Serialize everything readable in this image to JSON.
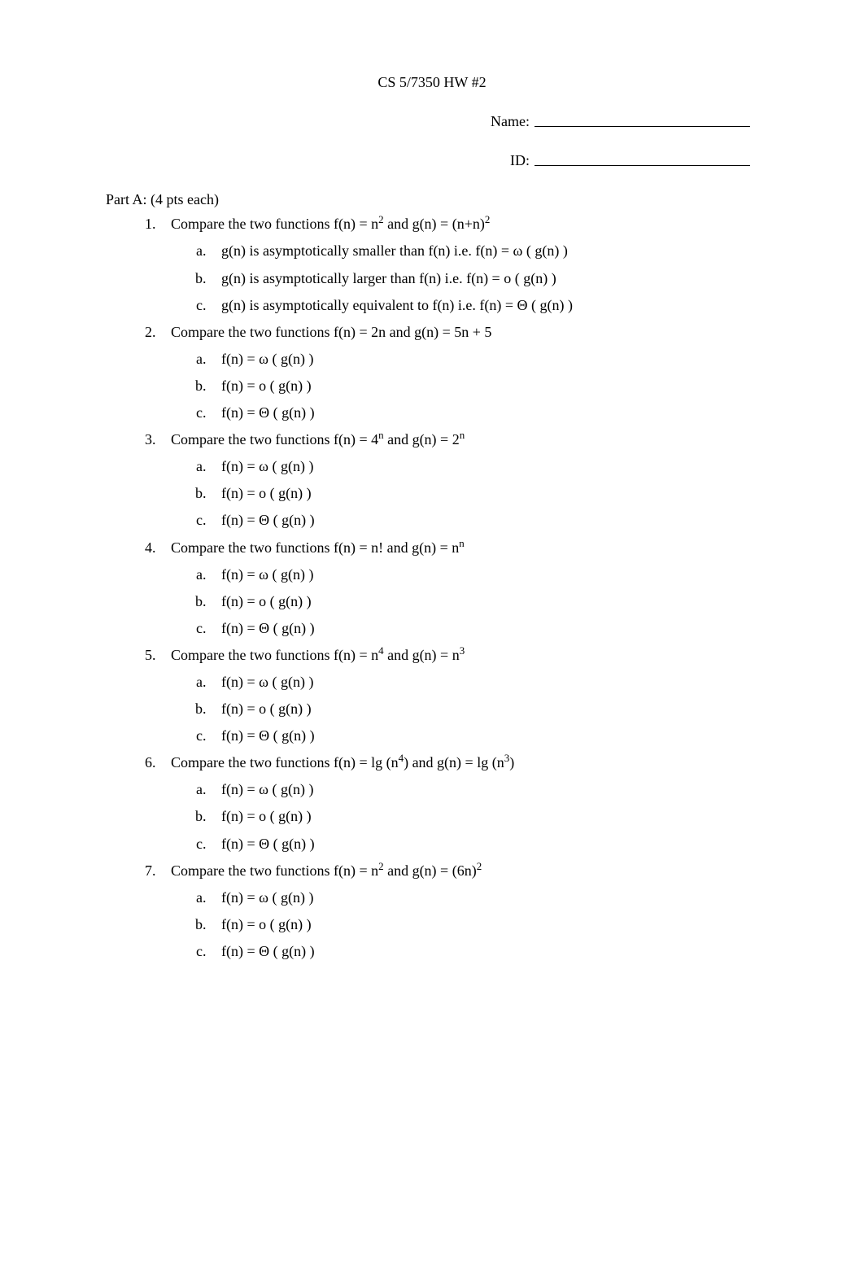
{
  "header": {
    "title": "CS 5/7350 HW #2",
    "name_label": "Name:",
    "name_value": "",
    "id_label": "ID:",
    "id_value": ""
  },
  "part_a": {
    "heading": "Part A: (4 pts each)",
    "questions": [
      {
        "prompt_html": "Compare the two functions f(n) = n<sup>2</sup> and g(n) =  (n+n)<sup>2</sup>",
        "choices_html": [
          "g(n) is asymptotically smaller than f(n) i.e. f(n) = ω ( g(n) )",
          "g(n) is asymptotically larger than f(n) i.e. f(n) = o ( g(n) )",
          "g(n) is asymptotically equivalent to f(n) i.e. f(n) = Θ ( g(n) )"
        ]
      },
      {
        "prompt_html": "Compare the two functions f(n) = 2n and g(n) = 5n + 5",
        "choices_html": [
          "f(n) = ω ( g(n) )",
          "f(n) = o ( g(n) )",
          "f(n) = Θ ( g(n) )"
        ]
      },
      {
        "prompt_html": "Compare the two functions f(n) = 4<sup>n</sup> and g(n) = 2<sup>n</sup>",
        "choices_html": [
          "f(n) = ω ( g(n) )",
          "f(n) = o ( g(n) )",
          "f(n) = Θ ( g(n) )"
        ]
      },
      {
        "prompt_html": "Compare the two functions f(n) = n! and g(n) =  n<sup>n</sup>",
        "choices_html": [
          "f(n) = ω ( g(n) )",
          "f(n) = o ( g(n) )",
          "f(n) = Θ ( g(n) )"
        ]
      },
      {
        "prompt_html": "Compare the two functions f(n) = n<sup>4</sup> and g(n) =  n<sup>3</sup>",
        "choices_html": [
          "f(n) = ω ( g(n) )",
          "f(n) = o ( g(n) )",
          "f(n) = Θ ( g(n) )"
        ]
      },
      {
        "prompt_html": "Compare the two functions f(n) = lg (n<sup>4</sup>) and g(n) = lg (n<sup>3</sup>)",
        "choices_html": [
          "f(n) = ω ( g(n) )",
          "f(n) = o ( g(n) )",
          "f(n) = Θ ( g(n) )"
        ]
      },
      {
        "prompt_html": "Compare the two functions f(n) = n<sup>2</sup> and g(n) =  (6n)<sup>2</sup>",
        "choices_html": [
          "f(n) = ω ( g(n) )",
          "f(n) = o ( g(n) )",
          "f(n) = Θ ( g(n) )"
        ]
      }
    ]
  }
}
